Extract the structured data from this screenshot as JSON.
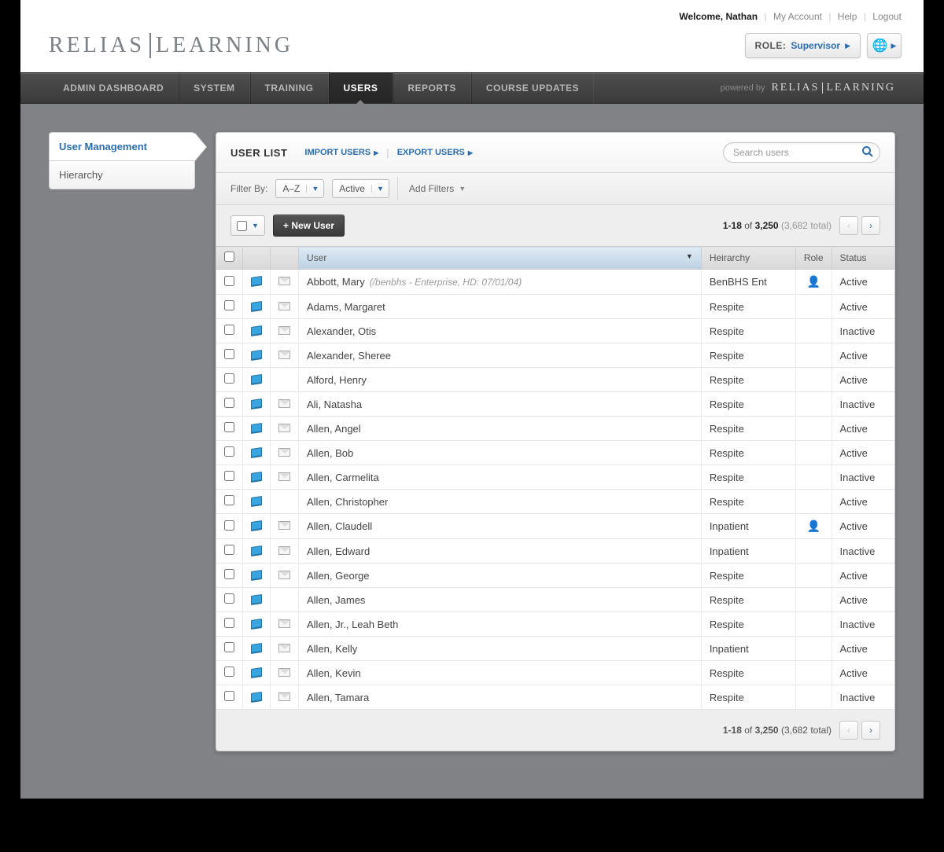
{
  "header": {
    "welcome": "Welcome, Nathan",
    "my_account": "My Account",
    "help": "Help",
    "logout": "Logout",
    "logo_left": "RELIAS",
    "logo_right": "LEARNING",
    "role_label": "ROLE:",
    "role_value": "Supervisor"
  },
  "nav": {
    "items": [
      "ADMIN DASHBOARD",
      "SYSTEM",
      "TRAINING",
      "USERS",
      "REPORTS",
      "COURSE UPDATES"
    ],
    "active_index": 3,
    "powered_by": "powered by",
    "plogo_left": "RELIAS",
    "plogo_right": "LEARNING"
  },
  "sidebar": {
    "items": [
      "User Management",
      "Hierarchy"
    ],
    "active_index": 0
  },
  "panel": {
    "title": "USER LIST",
    "import": "IMPORT USERS",
    "export": "EXPORT USERS",
    "search_placeholder": "Search users"
  },
  "filters": {
    "label": "Filter By:",
    "sort": "A–Z",
    "status": "Active",
    "add_filters": "Add Filters"
  },
  "toolbar": {
    "new_user": "+ New User"
  },
  "pagination": {
    "range": "1-18",
    "of": "of",
    "filtered": "3,250",
    "total": "(3,682 total)"
  },
  "table": {
    "headers": {
      "user": "User",
      "hierarchy": "Heirarchy",
      "role": "Role",
      "status": "Status"
    },
    "rows": [
      {
        "name": "Abbott, Mary",
        "sub": "(/benbhs - Enterprise, HD: 07/01/04)",
        "mail": true,
        "hierarchy": "BenBHS Ent",
        "role_icon": true,
        "status": "Active"
      },
      {
        "name": "Adams, Margaret",
        "mail": true,
        "hierarchy": "Respite",
        "status": "Active"
      },
      {
        "name": "Alexander, Otis",
        "mail": true,
        "hierarchy": "Respite",
        "status": "Inactive"
      },
      {
        "name": "Alexander, Sheree",
        "mail": true,
        "hierarchy": "Respite",
        "status": "Active"
      },
      {
        "name": "Alford, Henry",
        "mail": false,
        "hierarchy": "Respite",
        "status": "Active"
      },
      {
        "name": "Ali, Natasha",
        "mail": true,
        "hierarchy": "Respite",
        "status": "Inactive"
      },
      {
        "name": "Allen, Angel",
        "mail": true,
        "hierarchy": "Respite",
        "status": "Active"
      },
      {
        "name": "Allen, Bob",
        "mail": true,
        "hierarchy": "Respite",
        "status": "Active"
      },
      {
        "name": "Allen, Carmelita",
        "mail": true,
        "hierarchy": "Respite",
        "status": "Inactive"
      },
      {
        "name": "Allen, Christopher",
        "mail": false,
        "hierarchy": "Respite",
        "status": "Active"
      },
      {
        "name": "Allen, Claudell",
        "mail": true,
        "hierarchy": "Inpatient",
        "role_icon": true,
        "status": "Active"
      },
      {
        "name": "Allen, Edward",
        "mail": true,
        "hierarchy": "Inpatient",
        "status": "Inactive"
      },
      {
        "name": "Allen, George",
        "mail": true,
        "hierarchy": "Respite",
        "status": "Active"
      },
      {
        "name": "Allen, James",
        "mail": false,
        "hierarchy": "Respite",
        "status": "Active"
      },
      {
        "name": "Allen, Jr., Leah Beth",
        "mail": true,
        "hierarchy": "Respite",
        "status": "Inactive"
      },
      {
        "name": "Allen, Kelly",
        "mail": true,
        "hierarchy": "Inpatient",
        "status": "Active"
      },
      {
        "name": "Allen, Kevin",
        "mail": true,
        "hierarchy": "Respite",
        "status": "Active"
      },
      {
        "name": "Allen, Tamara",
        "mail": true,
        "hierarchy": "Respite",
        "status": "Inactive"
      }
    ]
  }
}
